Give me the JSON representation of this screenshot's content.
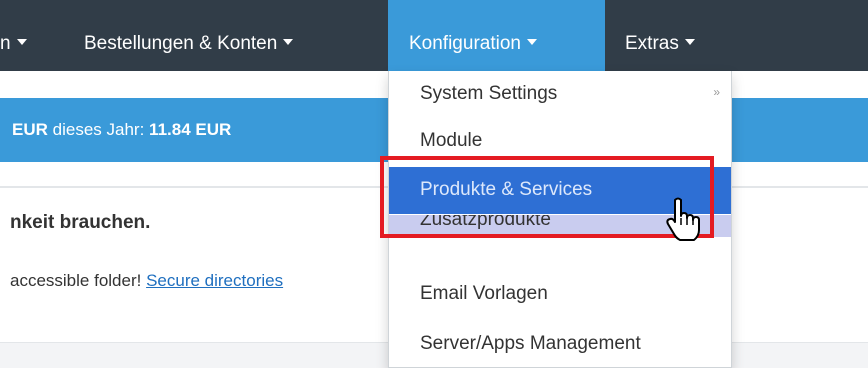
{
  "navbar": {
    "items": [
      {
        "label": "n"
      },
      {
        "label": "Bestellungen & Konten"
      },
      {
        "label": "Konfiguration"
      },
      {
        "label": "Extras"
      }
    ]
  },
  "stats": {
    "prefix_value": "EUR",
    "label": "dieses Jahr:",
    "value": "11.84 EUR"
  },
  "alert": {
    "title": "nkeit brauchen.",
    "text": "accessible folder!",
    "link": "Secure directories"
  },
  "dropdown": {
    "items": [
      {
        "label": "System Settings",
        "arrow": "»"
      },
      {
        "label": "Module"
      },
      {
        "label": "Produkte & Services"
      },
      {
        "label": "Zusatzprodukte"
      },
      {
        "label": "Email Vorlagen"
      },
      {
        "label": "Server/Apps Management"
      }
    ]
  },
  "colors": {
    "navbar": "#313d48",
    "accent_blue": "#3a9ad9",
    "highlight": "#2e6fd4",
    "annotation_red": "#e41b22"
  },
  "icons": [
    "caret-down-icon",
    "submenu-arrow-icon",
    "hand-pointer-cursor-icon"
  ]
}
